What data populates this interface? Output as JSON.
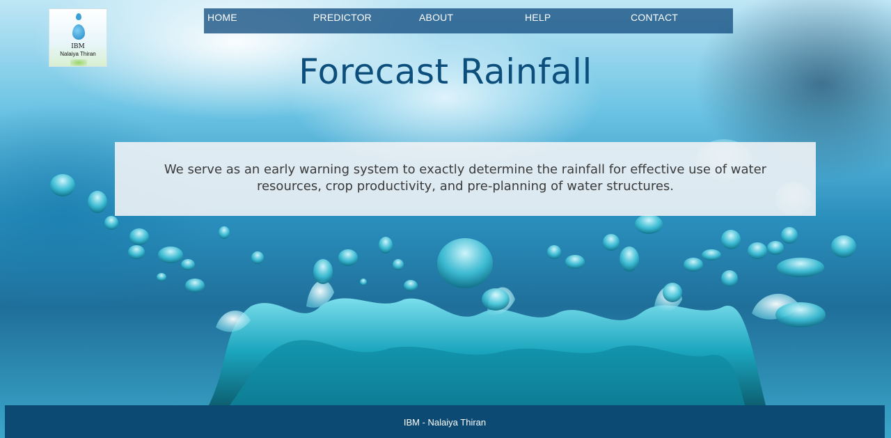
{
  "logo": {
    "line1": "IBM",
    "line2": "Nalaiya Thiran"
  },
  "nav": {
    "items": [
      {
        "label": "HOME"
      },
      {
        "label": "PREDICTOR"
      },
      {
        "label": "ABOUT"
      },
      {
        "label": "HELP"
      },
      {
        "label": "CONTACT"
      }
    ]
  },
  "hero": {
    "title": "Forecast Rainfall"
  },
  "about": {
    "text": "We serve as an early warning system to exactly determine the rainfall for effective use of water resources, crop productivity, and pre-planning of water structures."
  },
  "footer": {
    "text": "IBM - Nalaiya Thiran"
  },
  "colors": {
    "nav_bg": "#14507f",
    "title": "#0d4f7c",
    "footer_bg": "#0c4a73"
  }
}
